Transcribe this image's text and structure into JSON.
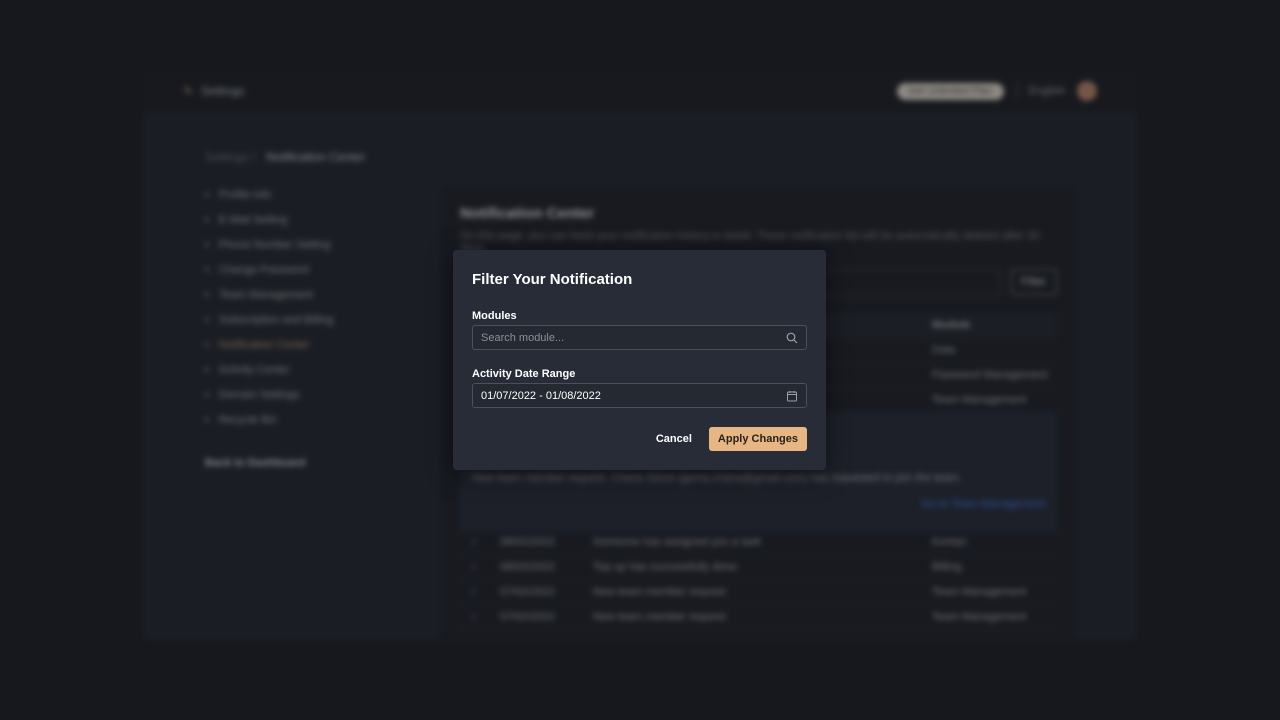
{
  "topbar": {
    "title": "Settings",
    "upgrade": "Get Unlimited Plan",
    "language": "English"
  },
  "breadcrumb": {
    "parent": "Settings",
    "current": "Notification Center"
  },
  "sidebar": {
    "items": [
      "Profile Info",
      "E-Mail Setting",
      "Phone Number Setting",
      "Change Password",
      "Team Management",
      "Subscription and Billing",
      "Notification Center",
      "Activity Center",
      "Domain Settings",
      "Recycle Bin"
    ],
    "active": 6,
    "back": "Back to Dashboard"
  },
  "main": {
    "title": "Notification Center",
    "description": "On this page, you can track your notification history in detail. These notification list will be automatically deleted after 30 days.",
    "filter_label": "Filter",
    "module_header": "Module",
    "rows_top": [
      {
        "module": "Data"
      },
      {
        "module": "Password Management"
      },
      {
        "module": "Team Management"
      }
    ],
    "expanded": {
      "message": "New team member request. Chana Stone (gema.chana@gmail.com) has requested to join the team.",
      "link": "Go to Team Management"
    },
    "rows": [
      {
        "date": "08/02/2022",
        "message": "Someone has assigned you a task",
        "module": "Kontan"
      },
      {
        "date": "08/02/2022",
        "message": "Top up has successfully done",
        "module": "Billing"
      },
      {
        "date": "07/02/2022",
        "message": "New team member request",
        "module": "Team Management"
      },
      {
        "date": "07/02/2022",
        "message": "New team member request",
        "module": "Team Management"
      }
    ]
  },
  "modal": {
    "title": "Filter Your Notification",
    "modules_label": "Modules",
    "modules_placeholder": "Search module...",
    "date_label": "Activity Date Range",
    "date_value": "01/07/2022 - 01/08/2022",
    "cancel": "Cancel",
    "apply": "Apply Changes"
  },
  "colors": {
    "accent": "#e6b785",
    "link": "#3b82f6"
  }
}
